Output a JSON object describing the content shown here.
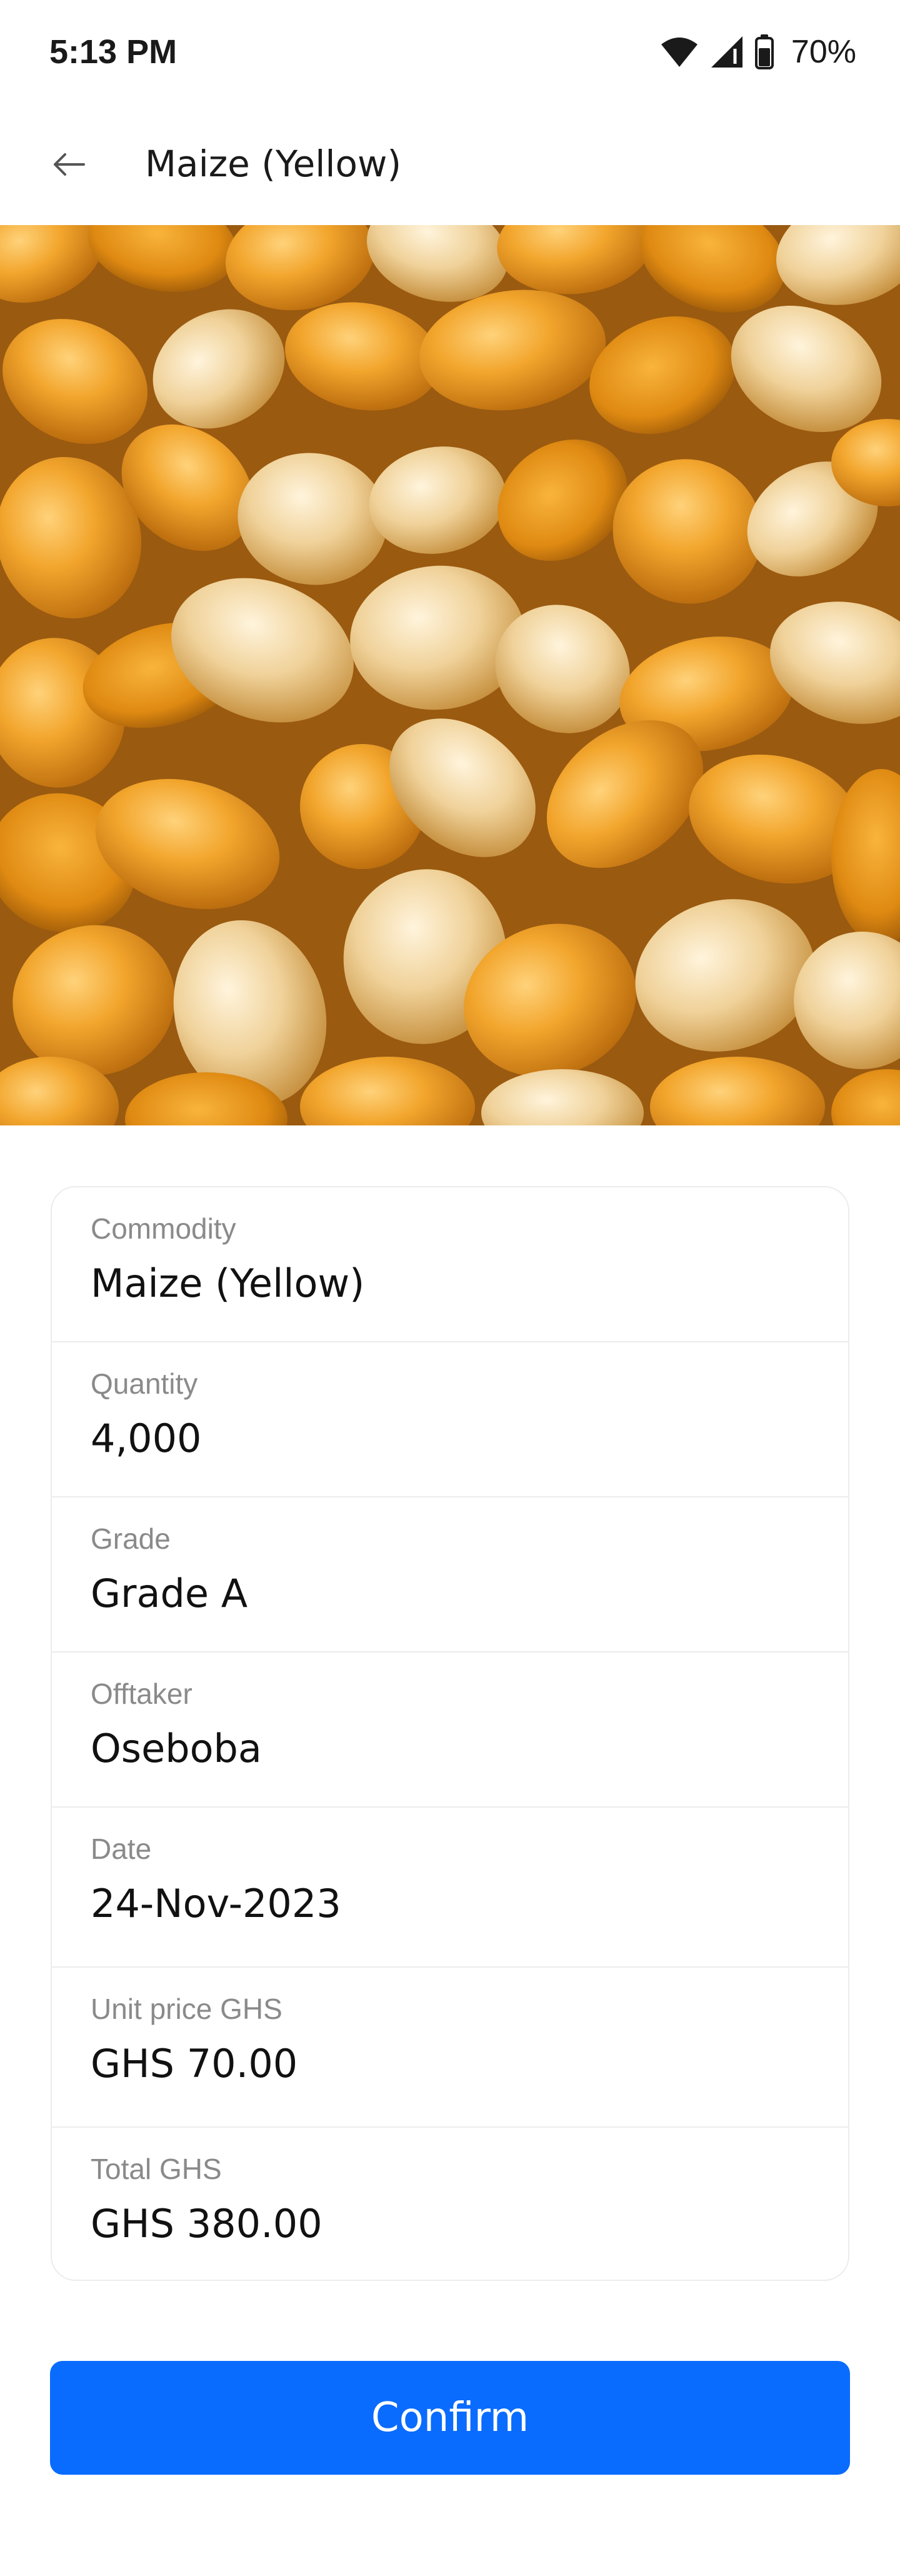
{
  "status_bar": {
    "time": "5:13 PM",
    "battery": "70%"
  },
  "header": {
    "title": "Maize (Yellow)"
  },
  "hero_image": {
    "subject": "yellow maize kernels"
  },
  "details": {
    "commodity": {
      "label": "Commodity",
      "value": "Maize (Yellow)"
    },
    "quantity": {
      "label": "Quantity",
      "value": "4,000"
    },
    "grade": {
      "label": "Grade",
      "value": "Grade A"
    },
    "offtaker": {
      "label": "Offtaker",
      "value": "Oseboba"
    },
    "date": {
      "label": "Date",
      "value": "24-Nov-2023"
    },
    "unit_price": {
      "label": "Unit price GHS",
      "value": "GHS 70.00"
    },
    "total": {
      "label": "Total GHS",
      "value": "GHS 380.00"
    }
  },
  "confirm": {
    "label": "Confirm"
  },
  "colors": {
    "accent": "#0a6bff",
    "border": "#ececec",
    "label": "#8a8a8a"
  },
  "icons": [
    "wifi-icon",
    "signal-icon",
    "battery-icon",
    "back-arrow-icon"
  ]
}
